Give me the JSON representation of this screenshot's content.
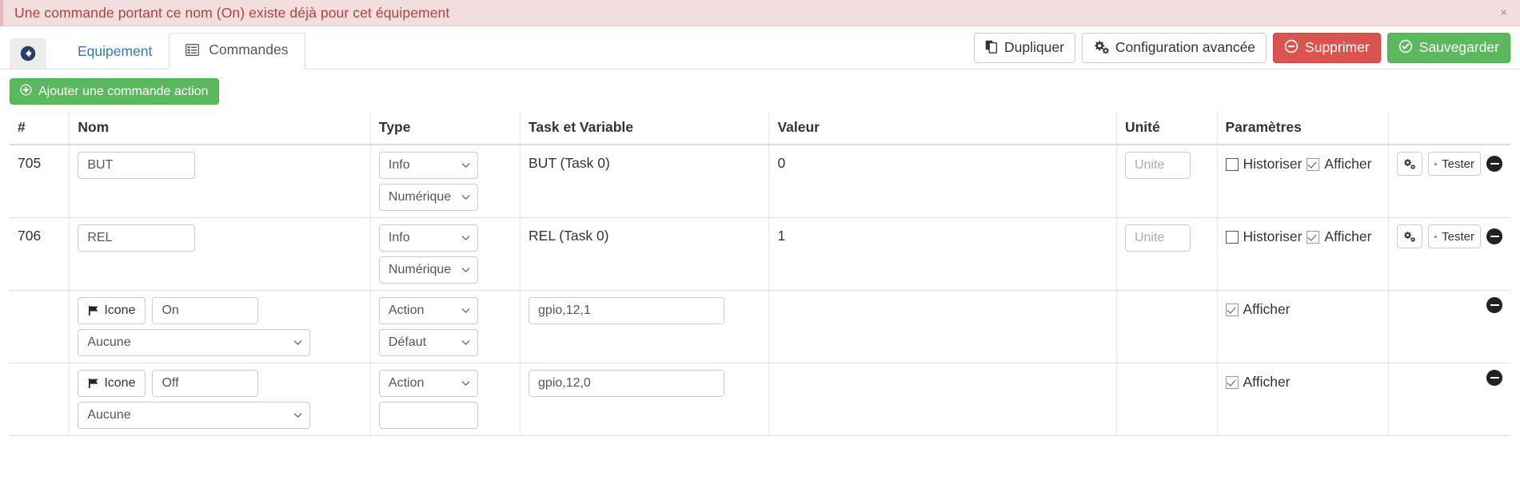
{
  "alert": {
    "message": "Une commande portant ce nom (On) existe déjà pour cet équipement",
    "close_label": "×",
    "bg_color": "#f2dede",
    "text_color": "#a94442"
  },
  "toolbar": {
    "back_label": "",
    "tabs": [
      {
        "label": "Equipement",
        "icon": "",
        "active": false
      },
      {
        "label": "Commandes",
        "icon": "list-icon",
        "active": true
      }
    ],
    "buttons": [
      {
        "label": "Dupliquer",
        "icon": "copy-icon",
        "style": "default"
      },
      {
        "label": "Configuration avancée",
        "icon": "gears-icon",
        "style": "default"
      },
      {
        "label": "Supprimer",
        "icon": "minus-circle-icon",
        "style": "danger",
        "color": "#d9534f"
      },
      {
        "label": "Sauvegarder",
        "icon": "check-circle-icon",
        "style": "success",
        "color": "#5cb85c"
      }
    ]
  },
  "add_button": {
    "label": "Ajouter une commande action",
    "icon": "plus-circle-icon",
    "color": "#5cb85c"
  },
  "table": {
    "headers": [
      "#",
      "Nom",
      "Type",
      "Task et Variable",
      "Valeur",
      "Unité",
      "Paramètres",
      ""
    ],
    "unit_placeholder": "Unite",
    "labels": {
      "historiser": "Historiser",
      "afficher": "Afficher",
      "tester": "Tester",
      "icone": "Icone"
    },
    "rows": [
      {
        "id": "705",
        "name": "BUT",
        "type_primary": "Info",
        "type_secondary": "Numérique",
        "task": "BUT (Task 0)",
        "value": "0",
        "unit": "",
        "historiser_checked": false,
        "afficher_checked": true,
        "show_historiser": true,
        "has_gear_button": true,
        "has_test_button": true,
        "kind": "info"
      },
      {
        "id": "706",
        "name": "REL",
        "type_primary": "Info",
        "type_secondary": "Numérique",
        "task": "REL (Task 0)",
        "value": "1",
        "unit": "",
        "historiser_checked": false,
        "afficher_checked": true,
        "show_historiser": true,
        "has_gear_button": true,
        "has_test_button": true,
        "kind": "info"
      },
      {
        "id": "",
        "name": "On",
        "icon_button": "Icone",
        "icon_select": "Aucune",
        "type_primary": "Action",
        "type_secondary": "Défaut",
        "task": "gpio,12,1",
        "value": "",
        "unit": "",
        "historiser_checked": false,
        "afficher_checked": true,
        "show_historiser": false,
        "has_gear_button": false,
        "has_test_button": false,
        "kind": "action"
      },
      {
        "id": "",
        "name": "Off",
        "icon_button": "Icone",
        "icon_select": "Aucune",
        "type_primary": "Action",
        "type_secondary": "",
        "task": "gpio,12,0",
        "value": "",
        "unit": "",
        "historiser_checked": false,
        "afficher_checked": true,
        "show_historiser": false,
        "has_gear_button": false,
        "has_test_button": false,
        "kind": "action"
      }
    ]
  }
}
